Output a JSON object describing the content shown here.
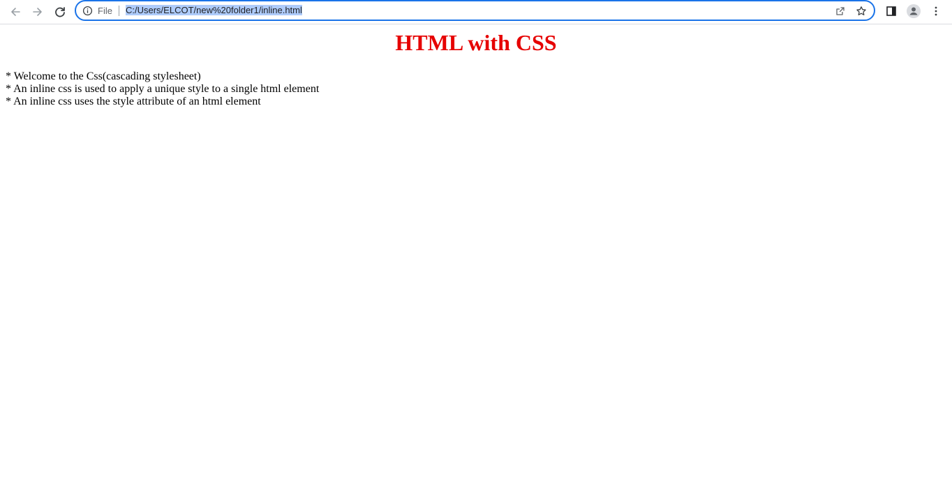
{
  "browser": {
    "site_info_label": "File",
    "url_text": "C:/Users/ELCOT/new%20folder1/inline.html"
  },
  "icons": {
    "back": "back-arrow-icon",
    "forward": "forward-arrow-icon",
    "reload": "reload-icon",
    "info": "info-icon",
    "share": "share-icon",
    "bookmark": "star-icon",
    "side_panel": "side-panel-icon",
    "profile": "profile-avatar-icon",
    "menu": "kebab-menu-icon"
  },
  "colors": {
    "title": "#e60000",
    "accent": "#1a73e8",
    "selection": "#aecbfa"
  },
  "page": {
    "title": "HTML with CSS",
    "lines": [
      "* Welcome to the Css(cascading stylesheet)",
      "* An inline css is used to apply a unique style to a single html element",
      "* An inline css uses the style attribute of an html element"
    ]
  }
}
